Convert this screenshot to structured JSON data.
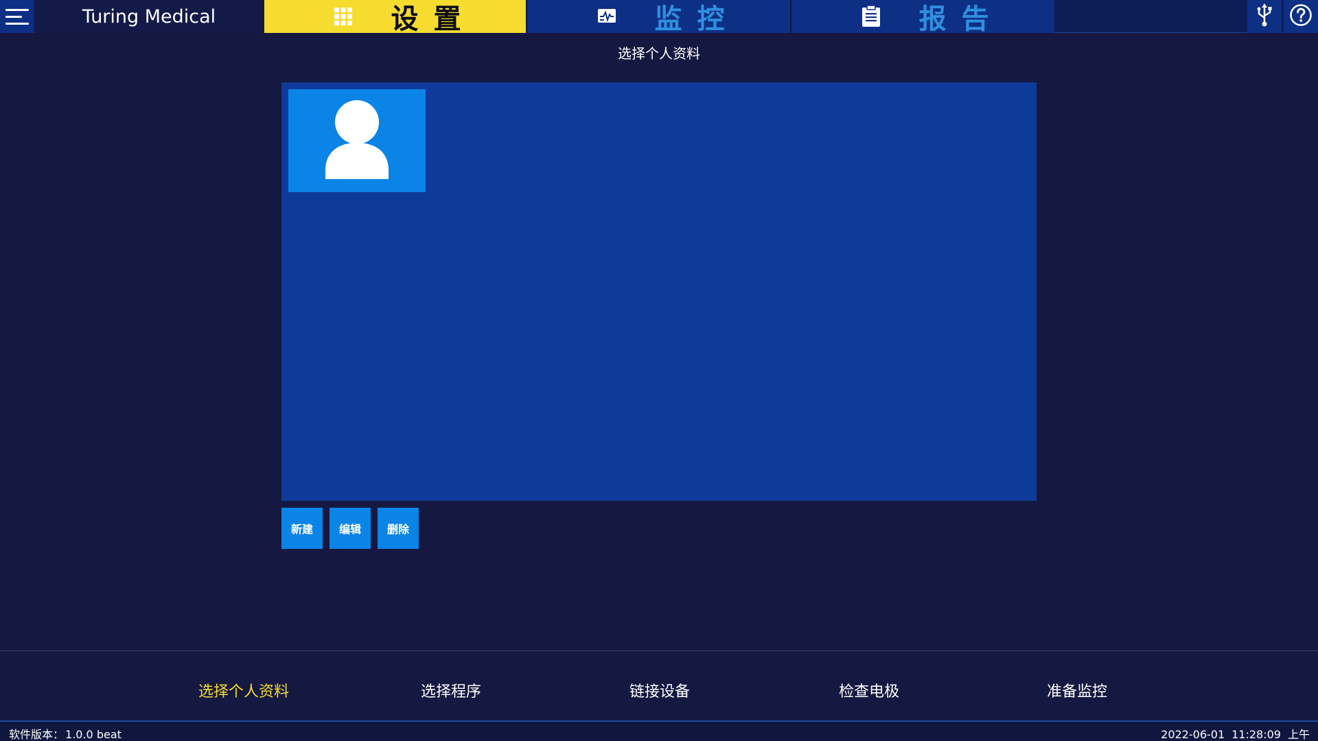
{
  "app": {
    "title": "Turing Medical"
  },
  "nav": {
    "tabs": [
      {
        "label": "设置",
        "icon": "grid-icon",
        "active": true
      },
      {
        "label": "监控",
        "icon": "monitor-icon",
        "active": false
      },
      {
        "label": "报告",
        "icon": "clipboard-icon",
        "active": false
      }
    ],
    "right_icons": [
      "usb-icon",
      "help-icon"
    ]
  },
  "main": {
    "section_title": "选择个人资料",
    "profiles": [
      {
        "icon": "user-avatar-icon"
      }
    ],
    "actions": {
      "new": "新建",
      "edit": "编辑",
      "delete": "删除"
    }
  },
  "steps": {
    "items": [
      {
        "label": "选择个人资料",
        "active": true
      },
      {
        "label": "选择程序",
        "active": false
      },
      {
        "label": "链接设备",
        "active": false
      },
      {
        "label": "检查电极",
        "active": false
      },
      {
        "label": "准备监控",
        "active": false
      }
    ]
  },
  "status": {
    "version_label": "软件版本：",
    "version": "1.0.0 beat",
    "date": "2022-06-01",
    "time": "11:28:09",
    "ampm": "上午"
  },
  "colors": {
    "background": "#151840",
    "active_tab": "#f5dc2f",
    "inactive_tab_text": "#2f8fe0",
    "panel": "#0e3a9a",
    "accent_button": "#0a84e6",
    "active_step": "#f5dc2f"
  }
}
